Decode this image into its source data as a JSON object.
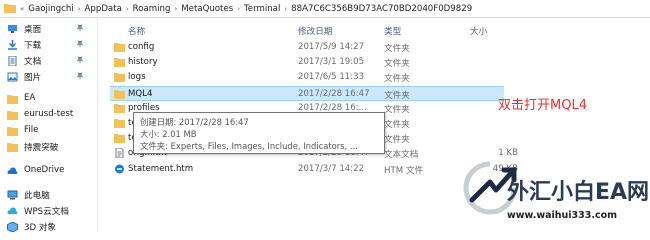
{
  "address": {
    "prefix": "«",
    "crumbs": [
      "Gaojingchi",
      "AppData",
      "Roaming",
      "MetaQuotes",
      "Terminal",
      "88A7C6C356B9D73AC70BD2040F0D9829"
    ]
  },
  "sidebar": {
    "items": [
      {
        "label": "桌面",
        "icon": "desktop-icon",
        "pinned": true
      },
      {
        "label": "下载",
        "icon": "download-icon",
        "pinned": true
      },
      {
        "label": "文档",
        "icon": "document-icon",
        "pinned": true
      },
      {
        "label": "图片",
        "icon": "picture-icon",
        "pinned": true
      },
      {
        "label": "EA",
        "icon": "folder-icon",
        "pinned": false
      },
      {
        "label": "eurusd-test",
        "icon": "folder-icon",
        "pinned": false
      },
      {
        "label": "File",
        "icon": "folder-icon",
        "pinned": false
      },
      {
        "label": "持震突破",
        "icon": "folder-icon",
        "pinned": false
      },
      {
        "label": "OneDrive",
        "icon": "onedrive-icon",
        "pinned": false
      },
      {
        "label": "此电脑",
        "icon": "computer-icon",
        "pinned": false
      },
      {
        "label": "WPS云文档",
        "icon": "cloud-icon",
        "pinned": false
      },
      {
        "label": "3D 对象",
        "icon": "3d-objects-icon",
        "pinned": false
      }
    ]
  },
  "columns": {
    "name": "名称",
    "date": "修改日期",
    "type": "类型",
    "size": "大小"
  },
  "files": [
    {
      "name": "config",
      "date": "2017/5/9 14:27",
      "type": "文件夹",
      "size": "",
      "icon": "folder-icon"
    },
    {
      "name": "history",
      "date": "2017/3/1 19:05",
      "type": "文件夹",
      "size": "",
      "icon": "folder-icon"
    },
    {
      "name": "logs",
      "date": "2017/6/5 11:33",
      "type": "文件夹",
      "size": "",
      "icon": "folder-icon"
    },
    {
      "name": "MQL4",
      "date": "2017/2/28 16:47",
      "type": "文件夹",
      "size": "",
      "icon": "folder-icon",
      "selected": true
    },
    {
      "name": "profiles",
      "date": "2017/2/28 16:...",
      "type": "文件夹",
      "size": "",
      "icon": "folder-icon"
    },
    {
      "name": "template",
      "date": "",
      "type": "文件夹",
      "size": "",
      "icon": "folder-icon"
    },
    {
      "name": "tester",
      "date": "",
      "type": "文件夹",
      "size": "",
      "icon": "folder-icon"
    },
    {
      "name": "origin.txt",
      "date": "2017/2/28 16:47",
      "type": "文本文档",
      "size": "1 KB",
      "icon": "text-file-icon"
    },
    {
      "name": "Statement.htm",
      "date": "2017/3/7 14:22",
      "type": "HTM 文件",
      "size": "49 KB",
      "icon": "edge-html-icon"
    }
  ],
  "tooltip": {
    "created": "创建日期: 2017/2/28 16:47",
    "size": "大小: 2.01 MB",
    "contents": "文件夹: Experts, Files, Images, Include, Indicators, ..."
  },
  "annotation": "双击打开MQL4",
  "watermark": {
    "text": "外汇小白EA网",
    "url": "www.waihui333.com"
  },
  "colors": {
    "selection": "#cce8ff",
    "folder": "#f0c35a",
    "annotation": "#ff2a2a",
    "header_text": "#4d6082"
  }
}
